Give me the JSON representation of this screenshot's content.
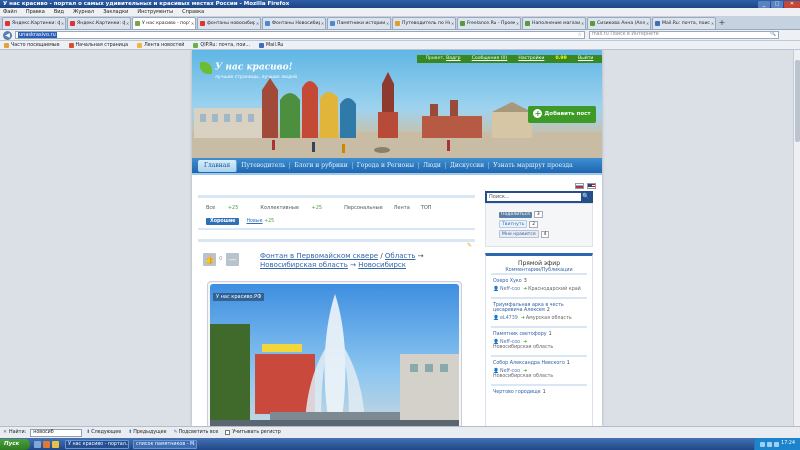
{
  "window": {
    "title": "У нас красиво - портал о самых удивительных и красивых местах России - Mozilla Firefox",
    "minimize": "_",
    "maximize": "□",
    "close": "✕"
  },
  "menu": [
    "Файл",
    "Правка",
    "Вид",
    "Журнал",
    "Закладки",
    "Инструменты",
    "Справка"
  ],
  "tabs": [
    {
      "label": "Яндекс.Картинки: фон...",
      "active": false
    },
    {
      "label": "Яндекс.Картинки: фон...",
      "active": false
    },
    {
      "label": "У нас красиво - портал...",
      "active": true
    },
    {
      "label": "фонтаны новосибирск...",
      "active": false
    },
    {
      "label": "Фонтаны Новосибирск...",
      "active": false
    },
    {
      "label": "Памятники истории и а...",
      "active": false
    },
    {
      "label": "Путеводитель по Ново...",
      "active": false
    },
    {
      "label": "Freelance.Ru - Проекты...",
      "active": false
    },
    {
      "label": "Наполнение магазина к...",
      "active": false
    },
    {
      "label": "Сизикова Анна (Anna_S...",
      "active": false
    },
    {
      "label": "Mail.Ru: почта, поиск в ...",
      "active": false
    }
  ],
  "nav": {
    "back": "◀",
    "url": "unaskrasivo.ru",
    "bookmark_star": "☆",
    "search_placeholder": "mail.ru Поиск в Интернете",
    "search_icon": "🔍"
  },
  "bookmarks": [
    {
      "label": "Часто посещаемые",
      "color": "#e2a33a"
    },
    {
      "label": "Начальная страница",
      "color": "#d9502c"
    },
    {
      "label": "Лента новостей",
      "color": "#f0b840"
    },
    {
      "label": "QIP.Ru: почта, пои...",
      "color": "#6ab04c"
    },
    {
      "label": "Mail.Ru",
      "color": "#3f6fb8"
    }
  ],
  "site": {
    "logo_title": "У нас красиво!",
    "logo_subtitle": "лучшие страницы, лучших людей",
    "userbar": {
      "greeting": "Привет,",
      "user": "Вадгр",
      "messages": "Сообщения (0)",
      "settings": "Настройки",
      "rating": "0.99",
      "logout": "Выйти"
    },
    "add_post": "Добавить пост",
    "add_post_icon": "+",
    "menu": [
      "Главная",
      "Путеводитель",
      "Блоги и рубрики",
      "Города и Регионы",
      "Люди",
      "Дискуссии",
      "Узнать маршрут проезда"
    ],
    "filter_tabs": [
      {
        "label": "Все",
        "count": "+25"
      },
      {
        "label": "Коллективные",
        "count": "+25"
      },
      {
        "label": "Персональные",
        "count": ""
      },
      {
        "label": "Лента",
        "count": ""
      },
      {
        "label": "ТОП",
        "count": ""
      }
    ],
    "filter_sub": {
      "good": "Хорошие",
      "new": "Новые",
      "new_count": "+25"
    },
    "post": {
      "vote_count": "0",
      "vote_up_icon": "👍",
      "vote_down_icon": "—",
      "edit_icon": "✎",
      "title": "Фонтан в Первомайском сквере",
      "sep1": "/",
      "category": "Область",
      "arrow1": "→",
      "region": "Новосибирская область",
      "arrow2": "→",
      "city": "Новосибирск",
      "watermark": "У нас красиво.РФ"
    },
    "sidebar": {
      "search_placeholder": "Поиск...",
      "search_icon": "🔍",
      "social": [
        {
          "label": "Поделиться",
          "count": "3",
          "kind": "vk"
        },
        {
          "label": "Твитнуть",
          "count": "2",
          "kind": "tw"
        },
        {
          "label": "Мне нравится",
          "count": "4",
          "kind": "fb"
        }
      ],
      "live_title": "Прямой эфир",
      "live_sub_a": "Комментарии",
      "live_sub_sep": "/",
      "live_sub_b": "Публикации",
      "live_items": [
        {
          "title": "Озеро Хуко",
          "count": "3",
          "user": "Neff-coo",
          "region": "Краснодарский край"
        },
        {
          "title": "Триумфальная арка в честь цесаревича Алексея",
          "count": "2",
          "user": "eL4739",
          "region": "Амурская область"
        },
        {
          "title": "Памятник светофору",
          "count": "1",
          "user": "Neff-coo",
          "region": "Новосибирская область"
        },
        {
          "title": "Собор Александра Невского",
          "count": "1",
          "user": "Neff-coo",
          "region": "Новосибирская область"
        },
        {
          "title": "Чертово городище",
          "count": "1",
          "user": "",
          "region": ""
        }
      ]
    }
  },
  "findbar": {
    "close": "✕",
    "label": "Найти:",
    "value": "новосиб",
    "next": "Следующее",
    "prev": "Предыдущее",
    "highlight": "Подсветить все",
    "match_case": "Учитывать регистр"
  },
  "taskbar": {
    "start": "Пуск",
    "tasks": [
      "У нас красиво - портал...",
      "список памятников - M..."
    ],
    "time": "17:24"
  }
}
